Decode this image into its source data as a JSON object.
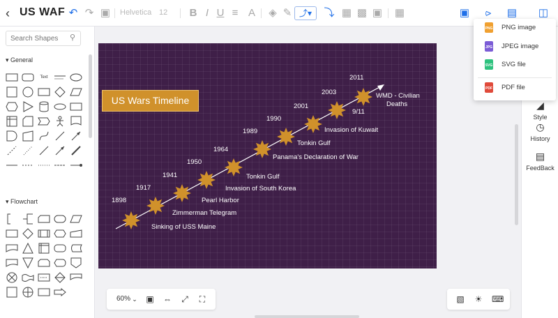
{
  "app": {
    "title": "US WAF"
  },
  "toolbar": {
    "font_family": "Helvetica",
    "font_size": "12",
    "colors": {
      "active": "#1f6fe8",
      "disabled": "#aaaaaa"
    }
  },
  "left_panel": {
    "search_placeholder": "Search Shapes",
    "sections": [
      {
        "label": "General"
      },
      {
        "label": "Flowchart"
      }
    ],
    "text_shape_label": "Text"
  },
  "diagram": {
    "title": "US Wars Timeline",
    "colors": {
      "background": "#3f1f48",
      "star": "#d0912b",
      "title_box": "#d0912b",
      "line": "#ffffff"
    },
    "events": [
      {
        "year": "1898",
        "label": "Sinking of USS Maine"
      },
      {
        "year": "1917",
        "label": "Zimmerman Telegram"
      },
      {
        "year": "1941",
        "label": "Pearl Harbor"
      },
      {
        "year": "1950",
        "label": "Invasion of South Korea"
      },
      {
        "year": "1964",
        "label": "Tonkin Gulf"
      },
      {
        "year": "1989",
        "label": "Panama's Declaration of War"
      },
      {
        "year": "1990",
        "label": "Tonkin Gulf"
      },
      {
        "year": "2001",
        "label": "Invasion of Kuwait"
      },
      {
        "year": "2003",
        "label": "9/11"
      },
      {
        "year": "2011",
        "label": "WMD - Civilian Deaths"
      }
    ]
  },
  "bottom": {
    "zoom": "60%"
  },
  "right_panel": {
    "items": [
      {
        "label": "Style",
        "icon": "style-icon"
      },
      {
        "label": "History",
        "icon": "clock-icon"
      },
      {
        "label": "FeedBack",
        "icon": "feedback-icon"
      }
    ]
  },
  "export_menu": {
    "items": [
      {
        "label": "PNG image",
        "badge": "PNG",
        "color": "#f0a030"
      },
      {
        "label": "JPEG image",
        "badge": "JPG",
        "color": "#7b5cd6"
      },
      {
        "label": "SVG file",
        "badge": "SVG",
        "color": "#2ec27e"
      },
      {
        "label": "PDF file",
        "badge": "PDF",
        "color": "#e04a3a"
      }
    ]
  }
}
